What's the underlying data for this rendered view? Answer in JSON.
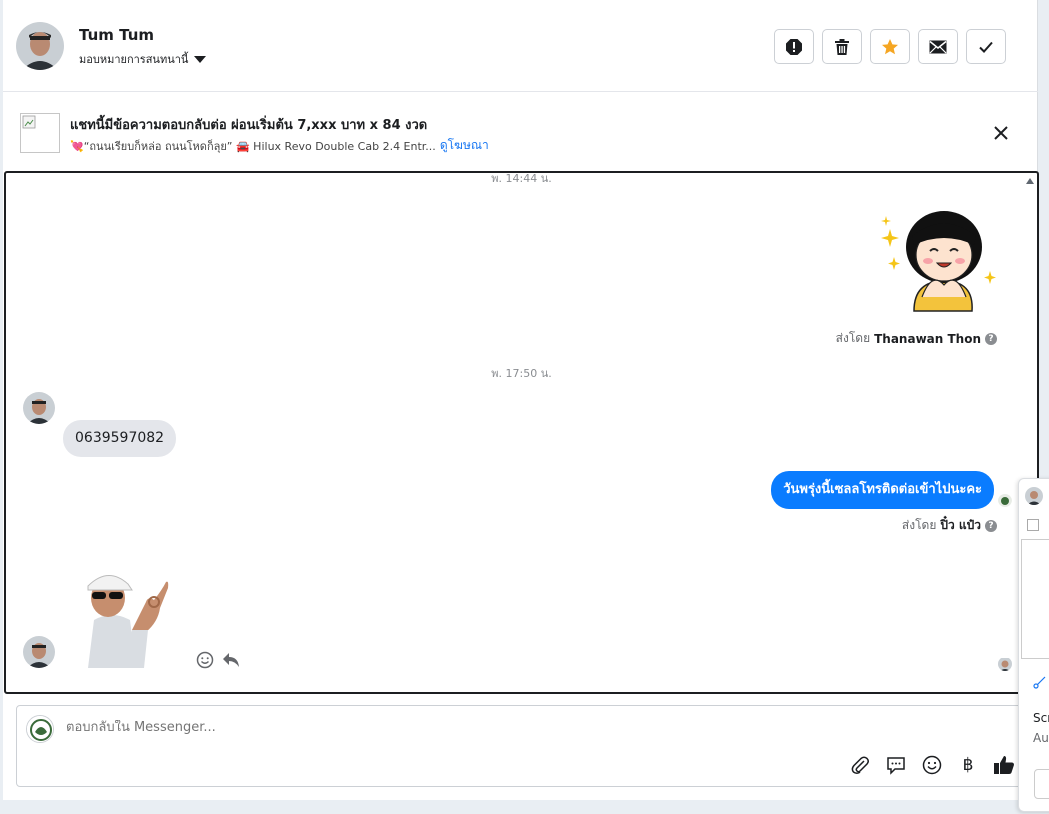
{
  "header": {
    "contact_name": "Tum Tum",
    "assign_label": "มอบหมายการสนทนานี้",
    "buttons": [
      "spam-icon",
      "trash-icon",
      "star-icon",
      "mail-icon",
      "check-icon"
    ],
    "star_color": "#f5a623"
  },
  "ad": {
    "title": "แชทนี้มีข้อความตอบกลับต่อ ผ่อนเริ่มต้น 7,xxx บาท x 84 งวด",
    "subtitle": "💘“ถนนเรียบก็หล่อ ถนนโหดก็ลุย” 🚘 Hilux Revo Double Cab 2.4 Entr...",
    "link": "ดูโฆษณา"
  },
  "conversation": {
    "timestamp_1": "พ. 14:44 น.",
    "sent_by_1_prefix": "ส่งโดย",
    "sent_by_1_name": "Thanawan Thon",
    "timestamp_2": "พ. 17:50 น.",
    "incoming_message": "0639597082",
    "outgoing_message": "วันพรุ่งนี้เซลลโทรติดต่อเข้าไปนะคะ",
    "outgoing_color": "#0a7cff",
    "sent_by_2_prefix": "ส่งโดย",
    "sent_by_2_name": "ปิ๋ว แป๋ว"
  },
  "composer": {
    "placeholder": "ตอบกลับใน Messenger...",
    "tools": [
      "attach-icon",
      "saved-reply-icon",
      "emoji-icon",
      "baht-icon",
      "like-icon"
    ]
  },
  "side_panel": {
    "text_1": "Scr",
    "text_2": "Au"
  }
}
